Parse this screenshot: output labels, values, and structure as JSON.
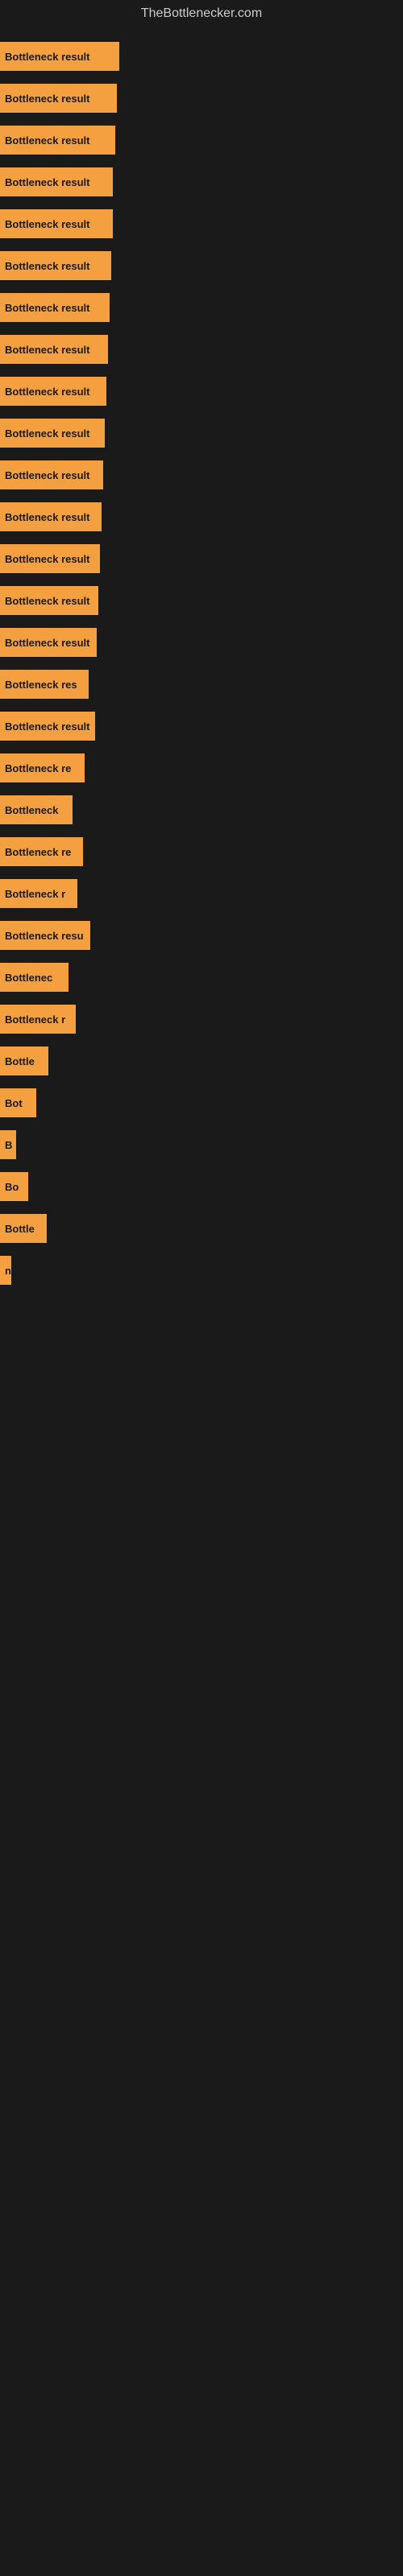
{
  "site": {
    "title": "TheBottlenecker.com"
  },
  "bars": [
    {
      "label": "Bottleneck result",
      "width": 148
    },
    {
      "label": "Bottleneck result",
      "width": 145
    },
    {
      "label": "Bottleneck result",
      "width": 143
    },
    {
      "label": "Bottleneck result",
      "width": 140
    },
    {
      "label": "Bottleneck result",
      "width": 140
    },
    {
      "label": "Bottleneck result",
      "width": 138
    },
    {
      "label": "Bottleneck result",
      "width": 136
    },
    {
      "label": "Bottleneck result",
      "width": 134
    },
    {
      "label": "Bottleneck result",
      "width": 132
    },
    {
      "label": "Bottleneck result",
      "width": 130
    },
    {
      "label": "Bottleneck result",
      "width": 128
    },
    {
      "label": "Bottleneck result",
      "width": 126
    },
    {
      "label": "Bottleneck result",
      "width": 124
    },
    {
      "label": "Bottleneck result",
      "width": 122
    },
    {
      "label": "Bottleneck result",
      "width": 120
    },
    {
      "label": "Bottleneck res",
      "width": 110
    },
    {
      "label": "Bottleneck result",
      "width": 118
    },
    {
      "label": "Bottleneck re",
      "width": 105
    },
    {
      "label": "Bottleneck",
      "width": 90
    },
    {
      "label": "Bottleneck re",
      "width": 103
    },
    {
      "label": "Bottleneck r",
      "width": 96
    },
    {
      "label": "Bottleneck resu",
      "width": 112
    },
    {
      "label": "Bottlenec",
      "width": 85
    },
    {
      "label": "Bottleneck r",
      "width": 94
    },
    {
      "label": "Bottle",
      "width": 60
    },
    {
      "label": "Bot",
      "width": 45
    },
    {
      "label": "B",
      "width": 20
    },
    {
      "label": "Bo",
      "width": 35
    },
    {
      "label": "Bottle",
      "width": 58
    },
    {
      "label": "n",
      "width": 14
    },
    {
      "label": "",
      "width": 0
    },
    {
      "label": "",
      "width": 0
    },
    {
      "label": "",
      "width": 0
    },
    {
      "label": "",
      "width": 0
    },
    {
      "label": "",
      "width": 0
    },
    {
      "label": "",
      "width": 0
    },
    {
      "label": "",
      "width": 0
    },
    {
      "label": "",
      "width": 0
    },
    {
      "label": "",
      "width": 0
    },
    {
      "label": "",
      "width": 0
    },
    {
      "label": "",
      "width": 0
    },
    {
      "label": "",
      "width": 0
    },
    {
      "label": "",
      "width": 0
    },
    {
      "label": "",
      "width": 0
    },
    {
      "label": "",
      "width": 0
    },
    {
      "label": "",
      "width": 0
    },
    {
      "label": "",
      "width": 0
    },
    {
      "label": "",
      "width": 0
    },
    {
      "label": "",
      "width": 0
    },
    {
      "label": "",
      "width": 0
    },
    {
      "label": "",
      "width": 0
    },
    {
      "label": "",
      "width": 0
    },
    {
      "label": "",
      "width": 0
    },
    {
      "label": "",
      "width": 0
    },
    {
      "label": "",
      "width": 0
    },
    {
      "label": "",
      "width": 0
    },
    {
      "label": "",
      "width": 0
    },
    {
      "label": "",
      "width": 0
    },
    {
      "label": "",
      "width": 0
    },
    {
      "label": "",
      "width": 0
    }
  ]
}
